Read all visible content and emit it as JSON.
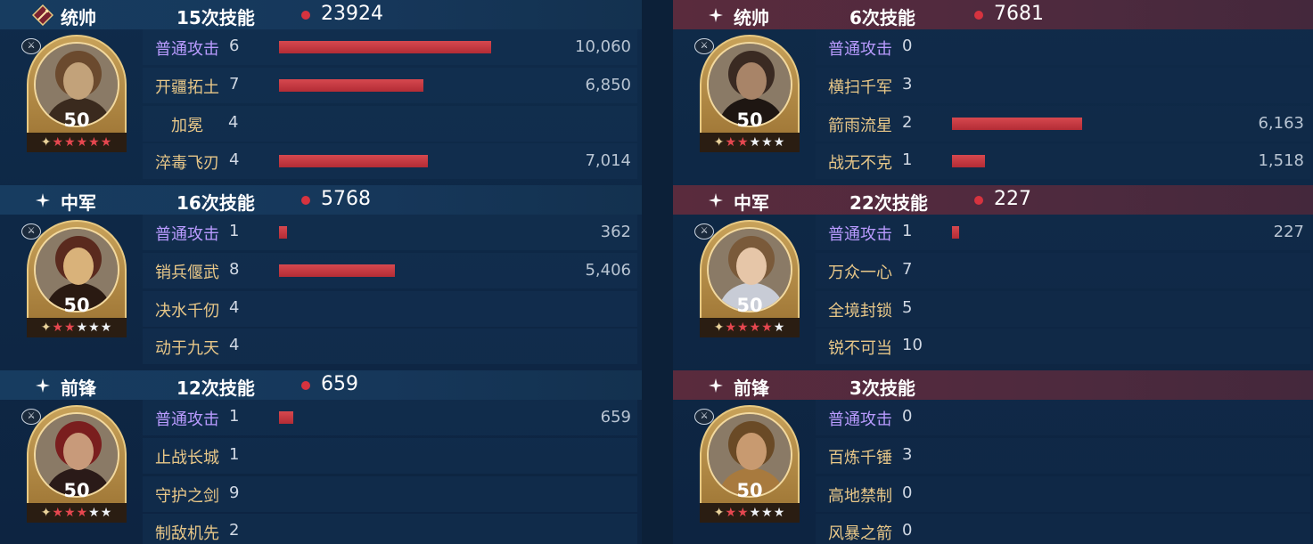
{
  "colors": {
    "blue_header": "#173c60",
    "red_header": "#5a2b3d",
    "bar_red": "#c8343d",
    "skill_gold": "#e8c788",
    "skill_purple": "#b99bff",
    "star_red": "#e5474f"
  },
  "left_team": {
    "sections": [
      {
        "position_label": "统帅",
        "position_icon": "crossed-swords-diamond-icon",
        "skill_count": "15次技能",
        "damage_total": "23924",
        "hero": {
          "level": "50",
          "stars": "✦★★★★★",
          "star_red": 5,
          "portrait": "warrior-with-feathered-helmet"
        },
        "skills": [
          {
            "name": "普通攻击",
            "level": "6",
            "value": "10,060",
            "ratio": 0.44,
            "style": "purple"
          },
          {
            "name": "开疆拓土",
            "level": "7",
            "value": "6,850",
            "ratio": 0.3,
            "style": "gold"
          },
          {
            "name": "加冕",
            "level": "4",
            "value": "",
            "ratio": 0,
            "style": "gold-center"
          },
          {
            "name": "淬毒飞刃",
            "level": "4",
            "value": "7,014",
            "ratio": 0.31,
            "style": "gold"
          }
        ]
      },
      {
        "position_label": "中军",
        "position_icon": "sparkle-icon",
        "skill_count": "16次技能",
        "damage_total": "5768",
        "hero": {
          "level": "50",
          "stars": "✦★★★★★",
          "star_red": 2,
          "portrait": "bearded-emperor"
        },
        "skills": [
          {
            "name": "普通攻击",
            "level": "1",
            "value": "362",
            "ratio": 0.016,
            "style": "purple"
          },
          {
            "name": "销兵偃武",
            "level": "8",
            "value": "5,406",
            "ratio": 0.24,
            "style": "gold"
          },
          {
            "name": "决水千仞",
            "level": "4",
            "value": "",
            "ratio": 0,
            "style": "gold"
          },
          {
            "name": "动于九天",
            "level": "4",
            "value": "",
            "ratio": 0,
            "style": "gold"
          }
        ]
      },
      {
        "position_label": "前锋",
        "position_icon": "sparkle-icon",
        "skill_count": "12次技能",
        "damage_total": "659",
        "hero": {
          "level": "50",
          "stars": "✦★★★★★",
          "star_red": 3,
          "portrait": "red-headband-warrior"
        },
        "skills": [
          {
            "name": "普通攻击",
            "level": "1",
            "value": "659",
            "ratio": 0.03,
            "style": "purple"
          },
          {
            "name": "止战长城",
            "level": "1",
            "value": "",
            "ratio": 0,
            "style": "gold"
          },
          {
            "name": "守护之剑",
            "level": "9",
            "value": "",
            "ratio": 0,
            "style": "gold"
          },
          {
            "name": "制敌机先",
            "level": "2",
            "value": "",
            "ratio": 0,
            "style": "gold"
          }
        ]
      }
    ]
  },
  "right_team": {
    "sections": [
      {
        "position_label": "统帅",
        "position_icon": "sparkle-icon",
        "skill_count": "6次技能",
        "damage_total": "7681",
        "hero": {
          "level": "50",
          "stars": "✦★★★★★",
          "star_red": 2,
          "portrait": "dark-haired-warrior"
        },
        "skills": [
          {
            "name": "普通攻击",
            "level": "0",
            "value": "",
            "ratio": 0,
            "style": "purple"
          },
          {
            "name": "横扫千军",
            "level": "3",
            "value": "",
            "ratio": 0,
            "style": "gold"
          },
          {
            "name": "箭雨流星",
            "level": "2",
            "value": "6,163",
            "ratio": 0.27,
            "style": "gold"
          },
          {
            "name": "战无不克",
            "level": "1",
            "value": "1,518",
            "ratio": 0.068,
            "style": "gold"
          }
        ]
      },
      {
        "position_label": "中军",
        "position_icon": "sparkle-icon",
        "skill_count": "22次技能",
        "damage_total": "227",
        "hero": {
          "level": "50",
          "stars": "✦★★★★★",
          "star_red": 4,
          "portrait": "young-female-knight"
        },
        "skills": [
          {
            "name": "普通攻击",
            "level": "1",
            "value": "227",
            "ratio": 0.01,
            "style": "purple"
          },
          {
            "name": "万众一心",
            "level": "7",
            "value": "",
            "ratio": 0,
            "style": "gold"
          },
          {
            "name": "全境封锁",
            "level": "5",
            "value": "",
            "ratio": 0,
            "style": "gold"
          },
          {
            "name": "锐不可当",
            "level": "10",
            "value": "",
            "ratio": 0,
            "style": "gold"
          }
        ]
      },
      {
        "position_label": "前锋",
        "position_icon": "sparkle-icon",
        "skill_count": "3次技能",
        "damage_total": "",
        "hero": {
          "level": "50",
          "stars": "✦★★★★★",
          "star_red": 2,
          "portrait": "blond-bearded-viking"
        },
        "skills": [
          {
            "name": "普通攻击",
            "level": "0",
            "value": "",
            "ratio": 0,
            "style": "purple"
          },
          {
            "name": "百炼千锤",
            "level": "3",
            "value": "",
            "ratio": 0,
            "style": "gold"
          },
          {
            "name": "高地禁制",
            "level": "0",
            "value": "",
            "ratio": 0,
            "style": "gold"
          },
          {
            "name": "风暴之箭",
            "level": "0",
            "value": "",
            "ratio": 0,
            "style": "gold"
          }
        ]
      }
    ]
  }
}
